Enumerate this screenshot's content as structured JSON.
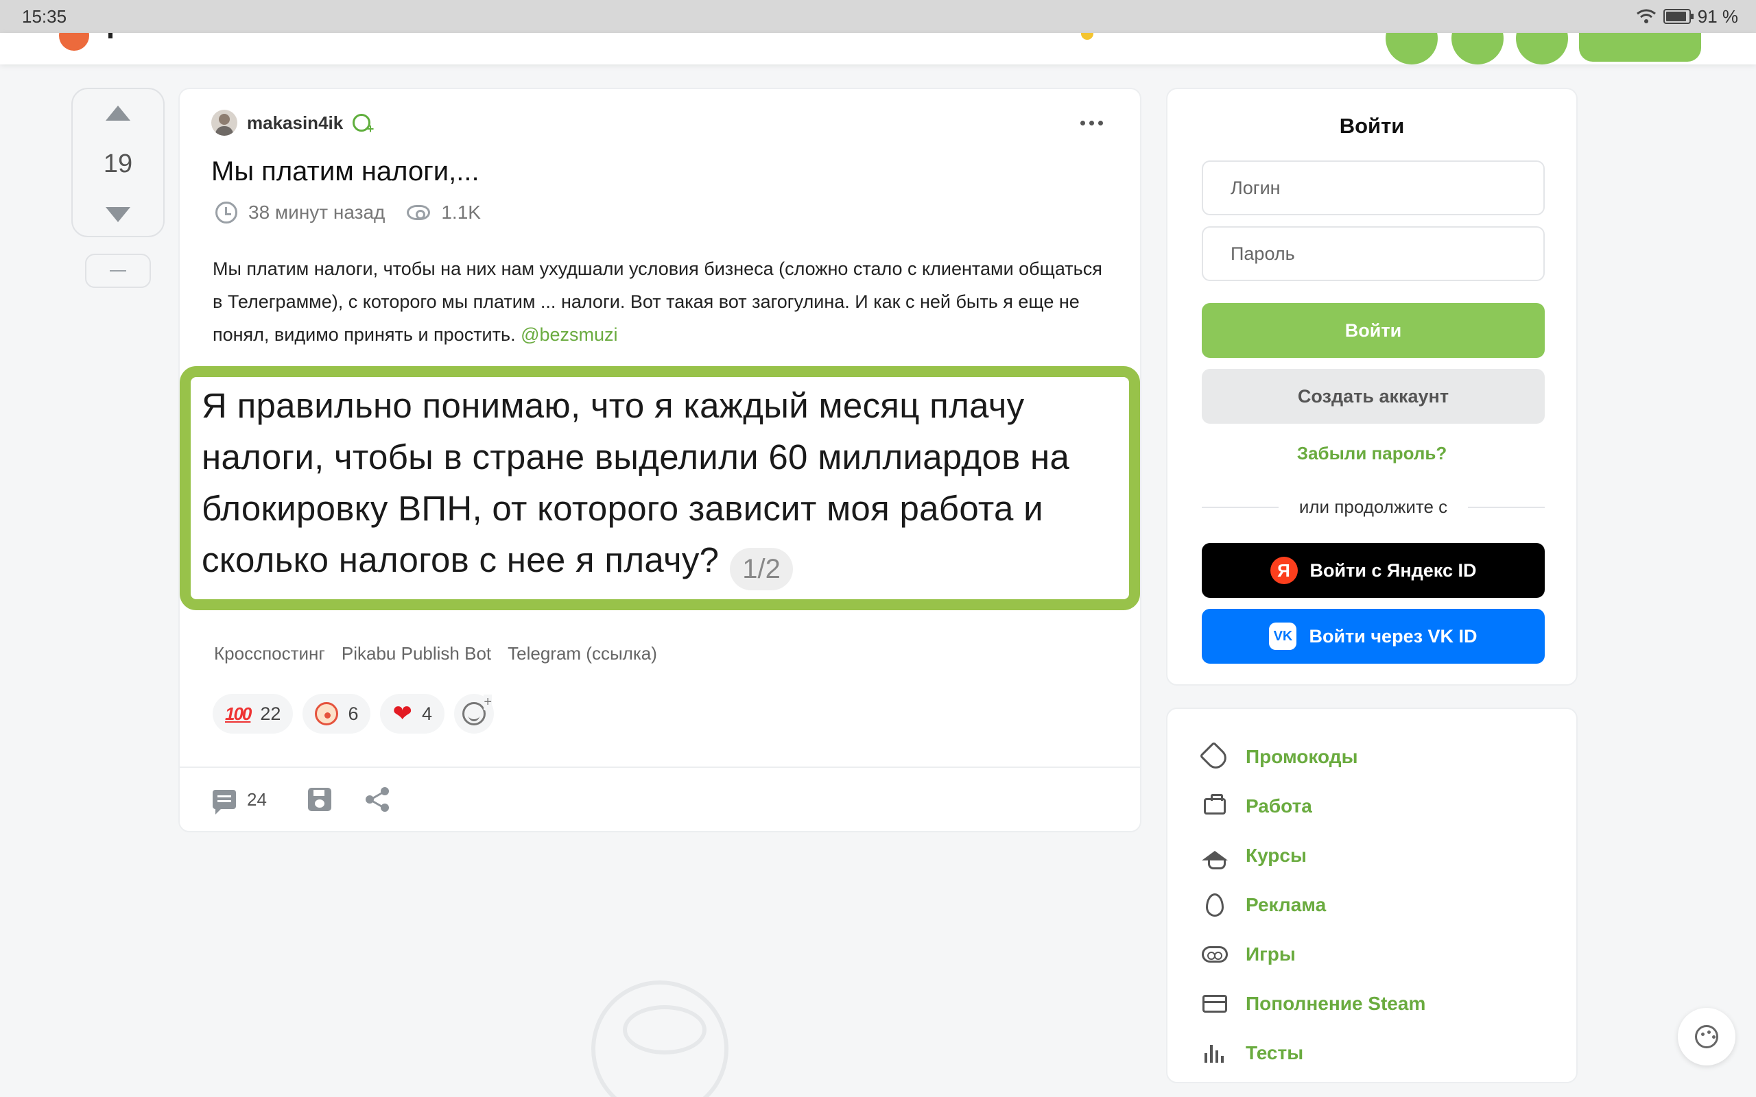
{
  "status_bar": {
    "time": "15:35",
    "battery": "91 %",
    "icons": [
      "wifi-icon",
      "battery-icon"
    ]
  },
  "colors": {
    "accent_green": "#8cc858",
    "link_green": "#6aab3f",
    "image_border": "#98c24a",
    "yandex_black": "#000000",
    "vk_blue": "#0077ff",
    "logo_orange": "#ec6a3c"
  },
  "post": {
    "rating": "19",
    "author": "makasin4ik",
    "title": "Мы платим налоги,...",
    "time_ago": "38 минут назад",
    "views": "1.1K",
    "body_text": "Мы платим налоги, чтобы на них нам ухудшали условия бизнеса (сложно стало с клиентами общаться в Телеграмме), с которого мы платим ... налоги. Вот такая вот загогулина. И как с ней быть я еще не понял, видимо принять и простить.",
    "mention": "@bezsmuzi",
    "image_text": "Я правильно понимаю, что я каждый месяц плачу налоги, чтобы в стране выделили 60 миллиардов на блокировку ВПН, от которого зависит моя работа и сколько налогов с нее я плачу?",
    "image_page": "1/2",
    "tags": [
      "Кросспостинг",
      "Pikabu Publish Bot",
      "Telegram (ссылка)"
    ],
    "reactions": [
      {
        "emoji": "💯",
        "count": "22"
      },
      {
        "emoji": "🤡",
        "count": "6"
      },
      {
        "emoji": "❤",
        "count": "4"
      }
    ],
    "comments_count": "24"
  },
  "login": {
    "title": "Войти",
    "login_placeholder": "Логин",
    "password_placeholder": "Пароль",
    "login_button": "Войти",
    "create_account": "Создать аккаунт",
    "forgot_password": "Забыли пароль?",
    "or_continue": "или продолжите с",
    "yandex_button": "Войти с Яндекс ID",
    "yandex_icon_letter": "Я",
    "vk_button": "Войти через VK ID",
    "vk_icon_letters": "VK"
  },
  "sidebar_links": [
    {
      "label": "Промокоды",
      "icon": "tag-icon"
    },
    {
      "label": "Работа",
      "icon": "briefcase-icon"
    },
    {
      "label": "Курсы",
      "icon": "graduation-cap-icon"
    },
    {
      "label": "Реклама",
      "icon": "fire-icon"
    },
    {
      "label": "Игры",
      "icon": "gamepad-icon"
    },
    {
      "label": "Пополнение Steam",
      "icon": "card-icon"
    },
    {
      "label": "Тесты",
      "icon": "bar-chart-icon"
    }
  ]
}
